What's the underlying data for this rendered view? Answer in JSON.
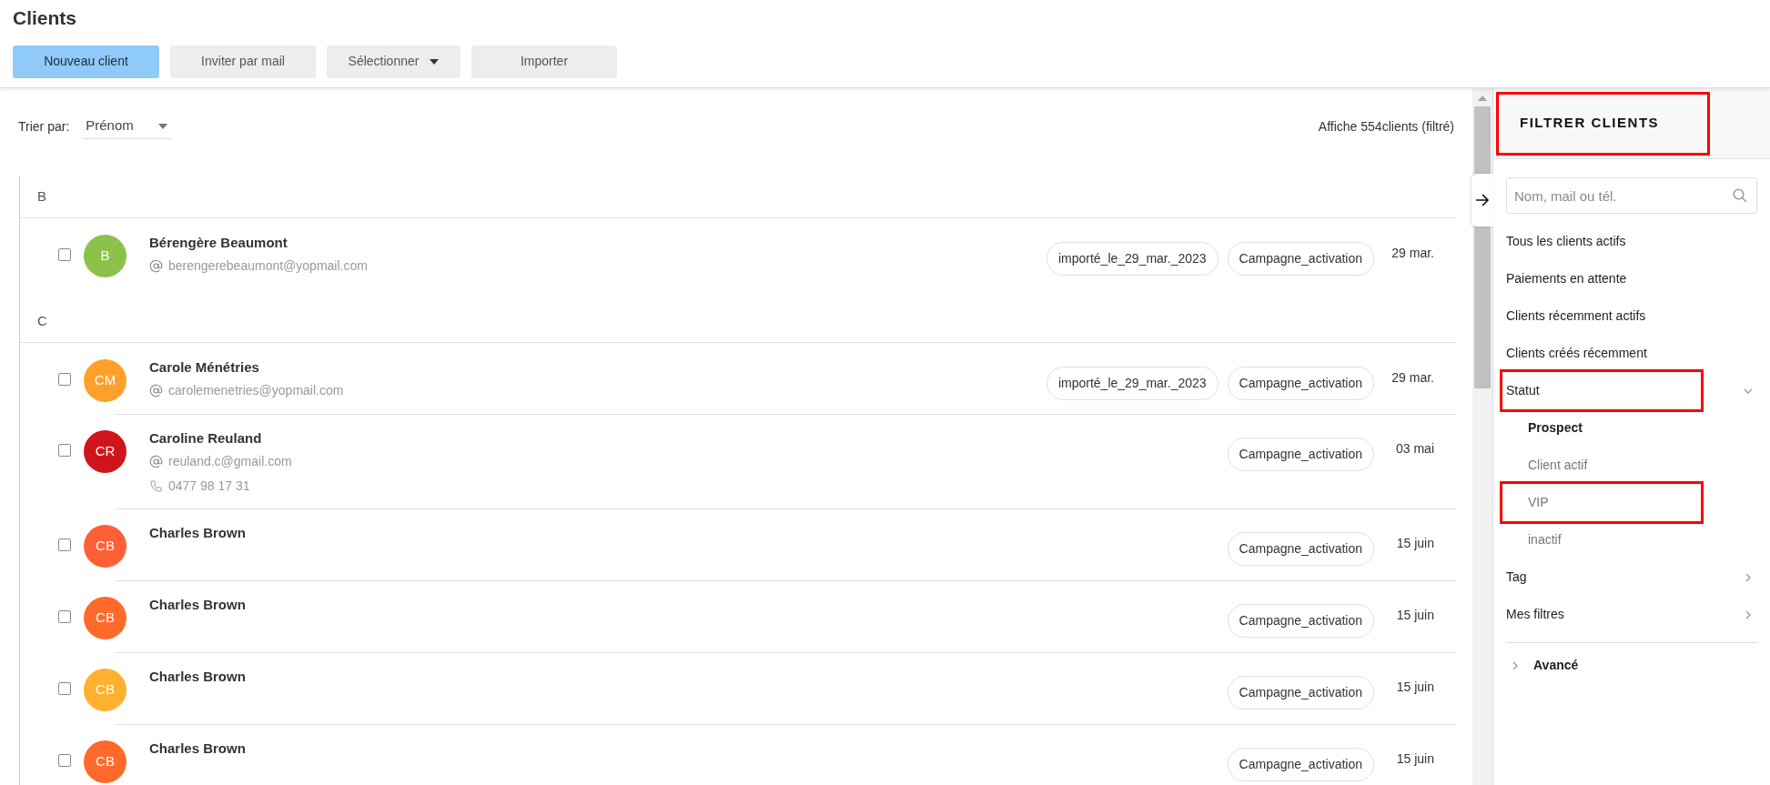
{
  "page": {
    "title": "Clients"
  },
  "toolbar": [
    {
      "label": "Nouveau client",
      "kind": "primary"
    },
    {
      "label": "Inviter par mail",
      "kind": "plain"
    },
    {
      "label": "Sélectionner",
      "kind": "dropdown"
    },
    {
      "label": "Importer",
      "kind": "plain"
    }
  ],
  "sort": {
    "label": "Trier par:",
    "value": "Prénom"
  },
  "count": "Affiche 554clients (filtré)",
  "groups": [
    {
      "letter": "B",
      "clients": [
        {
          "initials": "B",
          "color": "#8bc34a",
          "name": "Bérengère Beaumont",
          "email": "berengerebeaumont@yopmail.com",
          "tags": [
            "importé_le_29_mar._2023",
            "Campagne_activation"
          ],
          "date": "29 mar.",
          "checked": false
        }
      ]
    },
    {
      "letter": "C",
      "clients": [
        {
          "initials": "CM",
          "color": "#ffa02a",
          "name": "Carole Ménétries",
          "email": "carolemenetries@yopmail.com",
          "tags": [
            "importé_le_29_mar._2023",
            "Campagne_activation"
          ],
          "date": "29 mar.",
          "checked": false
        },
        {
          "initials": "CR",
          "color": "#d0141b",
          "name": "Caroline Reuland",
          "email": "reuland.c@gmail.com",
          "phone": "0477 98 17 31",
          "tags": [
            "Campagne_activation"
          ],
          "date": "03 mai",
          "checked": false
        },
        {
          "initials": "CB",
          "color": "#ff5f34",
          "name": "Charles Brown",
          "tags": [
            "Campagne_activation"
          ],
          "date": "15 juin",
          "checked": false
        },
        {
          "initials": "CB",
          "color": "#ff6a2a",
          "name": "Charles Brown",
          "tags": [
            "Campagne_activation"
          ],
          "date": "15 juin",
          "checked": false
        },
        {
          "initials": "CB",
          "color": "#ffb02e",
          "name": "Charles Brown",
          "tags": [
            "Campagne_activation"
          ],
          "date": "15 juin",
          "checked": false
        },
        {
          "initials": "CB",
          "color": "#ff6a2a",
          "name": "Charles Brown",
          "tags": [
            "Campagne_activation"
          ],
          "date": "15 juin",
          "checked": false
        }
      ]
    }
  ],
  "filter": {
    "title": "FILTRER CLIENTS",
    "highlighted": true,
    "search": {
      "placeholder": "Nom, mail ou tél."
    },
    "items": [
      {
        "label": "Tous les clients actifs",
        "kind": "link",
        "highlighted": false
      },
      {
        "label": "Paiements en attente",
        "kind": "link",
        "highlighted": false
      },
      {
        "label": "Clients récemment actifs",
        "kind": "link",
        "highlighted": false
      },
      {
        "label": "Clients créés récemment",
        "kind": "link",
        "highlighted": false
      },
      {
        "label": "Statut",
        "kind": "section",
        "expanded": true,
        "highlighted": true,
        "children": [
          {
            "label": "Prospect",
            "selected": true,
            "highlighted": false
          },
          {
            "label": "Client actif",
            "selected": false,
            "highlighted": false
          },
          {
            "label": "VIP",
            "selected": false,
            "highlighted": true
          },
          {
            "label": "inactif",
            "selected": false,
            "highlighted": false
          }
        ]
      },
      {
        "label": "Tag",
        "kind": "section",
        "expanded": false,
        "highlighted": false
      },
      {
        "label": "Mes filtres",
        "kind": "section",
        "expanded": false,
        "highlighted": false
      }
    ],
    "advanced": {
      "label": "Avancé",
      "expanded": false
    }
  }
}
